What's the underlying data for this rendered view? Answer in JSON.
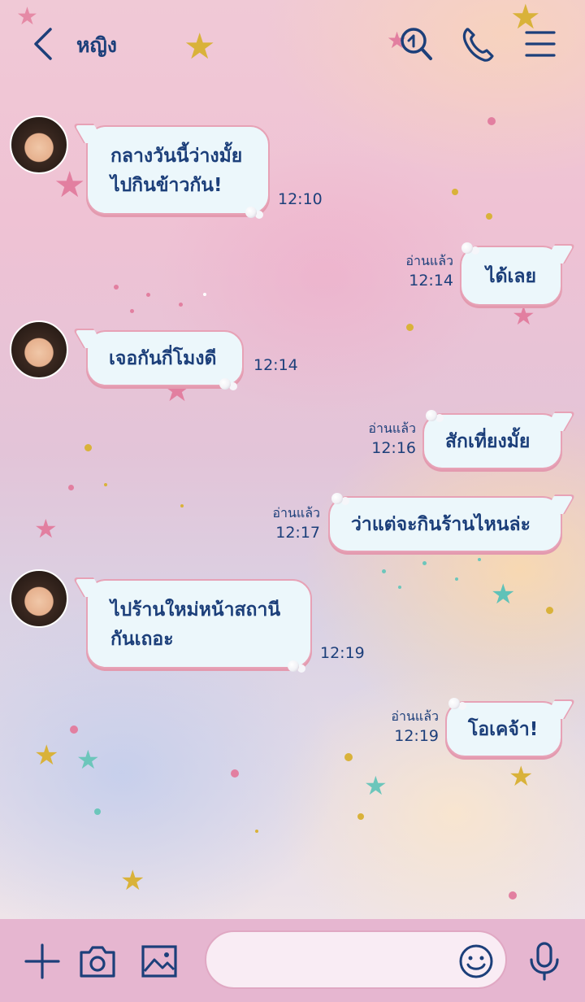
{
  "header": {
    "title": "หญิง",
    "back_icon": "chevron-left-icon",
    "icons": [
      "search-chat-icon",
      "phone-icon",
      "menu-icon"
    ]
  },
  "messages": [
    {
      "side": "left",
      "lines": [
        "กลางวันนี้ว่างมั้ย",
        "ไปกินข้าวกัน!"
      ],
      "time": "12:10"
    },
    {
      "side": "right",
      "lines": [
        "ได้เลย"
      ],
      "read": "อ่านแล้ว",
      "time": "12:14"
    },
    {
      "side": "left",
      "lines": [
        "เจอกันกี่โมงดี"
      ],
      "time": "12:14"
    },
    {
      "side": "right",
      "lines": [
        "สักเที่ยงมั้ย"
      ],
      "read": "อ่านแล้ว",
      "time": "12:16"
    },
    {
      "side": "right",
      "lines": [
        "ว่าแต่จะกินร้านไหนล่ะ"
      ],
      "read": "อ่านแล้ว",
      "time": "12:17"
    },
    {
      "side": "left",
      "lines": [
        "ไปร้านใหม่หน้าสถานี",
        "กันเถอะ"
      ],
      "time": "12:19"
    },
    {
      "side": "right",
      "lines": [
        "โอเคจ้า!"
      ],
      "read": "อ่านแล้ว",
      "time": "12:19"
    }
  ],
  "composer": {
    "placeholder": "",
    "icons": [
      "plus-icon",
      "camera-icon",
      "image-icon",
      "emoji-icon",
      "microphone-icon"
    ]
  },
  "colors": {
    "accent": "#1c3f7a",
    "bubble_fill": "#ecf7fb",
    "bubble_border": "#e7a2b6",
    "bottom_bar": "#e6b6d0"
  }
}
